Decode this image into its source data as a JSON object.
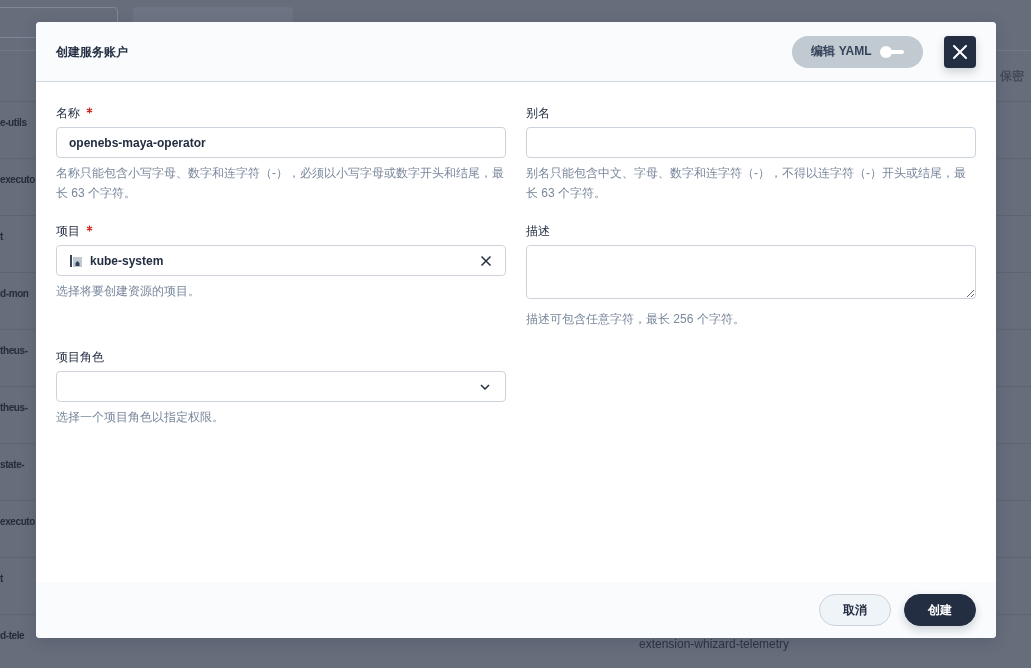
{
  "background_table": {
    "column_3_heading": "保密",
    "rows": [
      {
        "column_1": "e-utils"
      },
      {
        "column_1": "executo"
      },
      {
        "column_1": "t"
      },
      {
        "column_1": "d-mon"
      },
      {
        "column_1": "theus-"
      },
      {
        "column_1": "theus-"
      },
      {
        "column_1": "state-"
      },
      {
        "column_1": "executo"
      },
      {
        "column_1": "t"
      },
      {
        "column_1": "d-tele",
        "column_2": "extension-whizard-telemetry"
      }
    ]
  },
  "modal": {
    "title": "创建服务账户",
    "yaml_toggle": {
      "label": "编辑 YAML",
      "on": false
    },
    "fields": [
      {
        "kind": "input",
        "label": "名称",
        "required": true,
        "value": "openebs-maya-operator",
        "hint": "名称只能包含小写字母、数字和连字符（-），必须以小写字母或数字开头和结尾，最长 63 个字符。"
      },
      {
        "kind": "input",
        "label": "别名",
        "required": false,
        "hint": "别名只能包含中文、字母、数字和连字符（-），不得以连字符（-）开头或结尾，最长 63 个字符。"
      },
      {
        "kind": "select",
        "label": "项目",
        "required": true,
        "value": "kube-system",
        "hint": "选择将要创建资源的项目。"
      },
      {
        "kind": "textarea",
        "label": "描述",
        "required": false,
        "hint": "描述可包含任意字符，最长 256 个字符。"
      },
      {
        "kind": "select",
        "label": "项目角色",
        "required": false,
        "hint": "选择一个项目角色以指定权限。"
      }
    ],
    "buttons": [
      {
        "label": "取消",
        "kind": "secondary"
      },
      {
        "label": "创建",
        "kind": "primary"
      }
    ]
  }
}
